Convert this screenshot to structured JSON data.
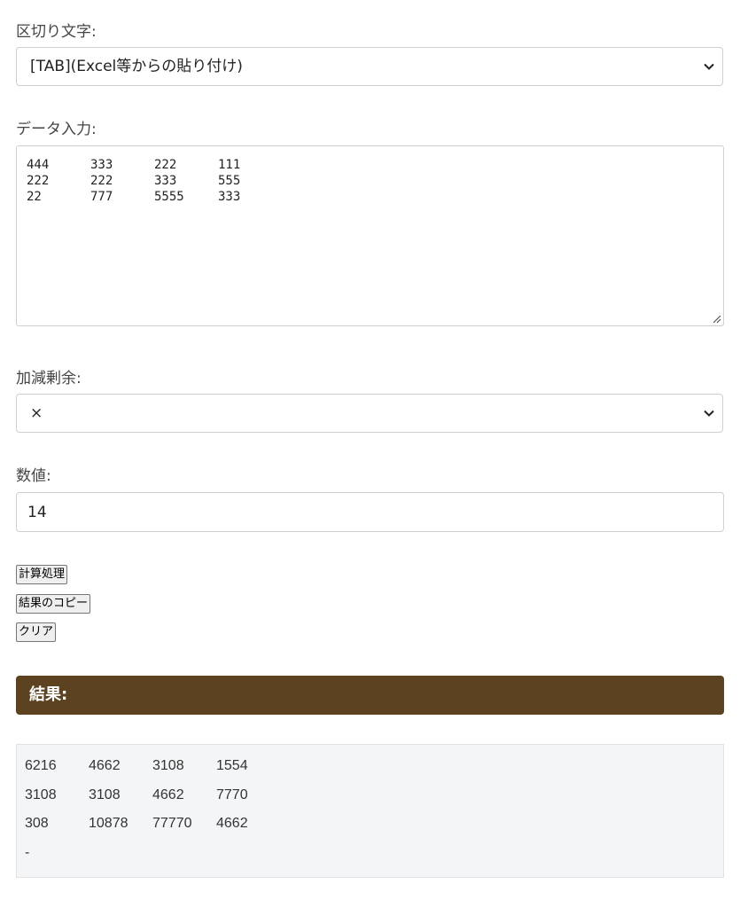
{
  "delimiter": {
    "label": "区切り文字:",
    "selected": "[TAB](Excel等からの貼り付け)"
  },
  "data_input": {
    "label": "データ入力:",
    "rows": [
      [
        "444",
        "333",
        "222",
        "111"
      ],
      [
        "222",
        "222",
        "333",
        "555"
      ],
      [
        "22",
        "777",
        "5555",
        "333"
      ]
    ]
  },
  "operation": {
    "label": "加減剰余:",
    "selected": "×"
  },
  "number": {
    "label": "数値:",
    "value": "14"
  },
  "buttons": {
    "calculate": "計算処理",
    "copy": "結果のコピー",
    "clear": "クリア"
  },
  "result": {
    "header": "結果:",
    "rows": [
      [
        "6216",
        "4662",
        "3108",
        "1554"
      ],
      [
        "3108",
        "3108",
        "4662",
        "7770"
      ],
      [
        "308",
        "10878",
        "77770",
        "4662"
      ],
      [
        "-"
      ]
    ]
  },
  "icons": {
    "select_arrow": "chevron-down-icon",
    "textarea_grip": "resize-grip-icon"
  }
}
